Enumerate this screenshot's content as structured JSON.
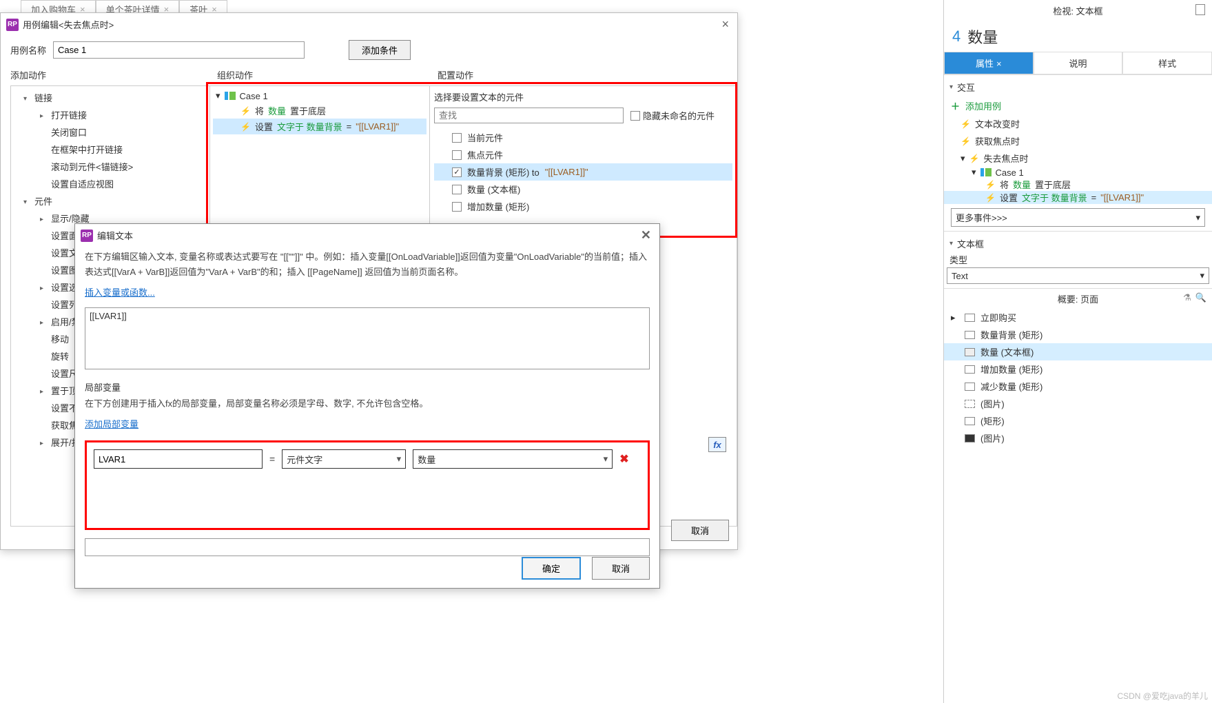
{
  "bg_tabs": [
    "加入购物车",
    "单个茶叶详情",
    "茶叶"
  ],
  "inspector": "检视: 文本框",
  "dialog1": {
    "title": "用例编辑<失去焦点时>",
    "case_label": "用例名称",
    "case_value": "Case 1",
    "add_cond": "添加条件",
    "headers": {
      "add_action": "添加动作",
      "org_action": "组织动作",
      "cfg_action": "配置动作"
    },
    "tree": {
      "links": "链接",
      "open_link": "打开链接",
      "close_win": "关闭窗口",
      "open_in_frame": "在框架中打开链接",
      "scroll_to": "滚动到元件<锚链接>",
      "set_adaptive": "设置自适应视图",
      "widgets": "元件",
      "show_hide": "显示/隐藏",
      "set_panel": "设置面板",
      "set_text": "设置文",
      "set_image": "设置图片",
      "set_sel": "设置选中",
      "set_list": "设置列表",
      "enable": "启用/禁用",
      "move": "移动",
      "rotate": "旋转",
      "set_size": "设置尺寸",
      "to_top": "置于顶",
      "set_opac": "设置不透",
      "get_focus": "获取焦点",
      "expand": "展开/折叠"
    },
    "mid": {
      "case_label": "Case 1",
      "act1_prefix": "将 ",
      "act1_green": "数量",
      "act1_suffix": " 置于底层",
      "act2_prefix": "设置 ",
      "act2_green": "文字于 数量背景",
      "act2_eq": " = ",
      "act2_val": "\"[[LVAR1]]\""
    },
    "right": {
      "header": "选择要设置文本的元件",
      "search_ph": "查找",
      "hide_unnamed": "隐藏未命名的元件",
      "rows": [
        {
          "label": "当前元件",
          "checked": false
        },
        {
          "label": "焦点元件",
          "checked": false
        },
        {
          "label_pre": "数量背景 (矩形) to ",
          "label_val": "\"[[LVAR1]]\"",
          "checked": true,
          "selected": true
        },
        {
          "label": "数量 (文本框)",
          "checked": false
        },
        {
          "label": "增加数量 (矩形)",
          "checked": false
        }
      ]
    },
    "cancel": "取消",
    "fx": "fx"
  },
  "dialog2": {
    "title": "编辑文本",
    "desc": "在下方编辑区输入文本, 变量名称或表达式要写在 \"[[\"\"]]\" 中。例如：插入变量[[OnLoadVariable]]返回值为变量\"OnLoadVariable\"的当前值；插入表达式[[VarA + VarB]]返回值为\"VarA + VarB\"的和；插入 [[PageName]] 返回值为当前页面名称。",
    "insert_var": "插入变量或函数...",
    "textarea": "[[LVAR1]]",
    "local_var": "局部变量",
    "local_desc": "在下方创建用于插入fx的局部变量，局部变量名称必须是字母、数字, 不允许包含空格。",
    "add_local": "添加局部变量",
    "row": {
      "name": "LVAR1",
      "type": "元件文字",
      "target": "数量"
    },
    "ok": "确定",
    "cancel": "取消"
  },
  "rpanel": {
    "big4": "4",
    "qty": "数量",
    "tabs": [
      "属性",
      "说明",
      "样式"
    ],
    "interaction": "交互",
    "add_case": "添加用例",
    "events": {
      "text_change": "文本改变时",
      "got_focus": "获取焦点时",
      "lost_focus": "失去焦点时"
    },
    "case": "Case 1",
    "act1_prefix": "将 ",
    "act1_green": "数量",
    "act1_suffix": " 置于底层",
    "act2_prefix": "设置 ",
    "act2_green": "文字于 数量背景",
    "act2_eq": " = ",
    "act2_val": "\"[[LVAR1]]\"",
    "more": "更多事件>>>",
    "textbox": "文本框",
    "type_label": "类型",
    "type_value": "Text",
    "outline": "概要: 页面",
    "buy_now": "立即购买",
    "outline_items": [
      {
        "label": "数量背景 (矩形)"
      },
      {
        "label": "数量 (文本框)",
        "selected": true
      },
      {
        "label": "增加数量 (矩形)"
      },
      {
        "label": "减少数量 (矩形)"
      },
      {
        "label": "(图片)",
        "dash": true
      },
      {
        "label": "(矩形)"
      },
      {
        "label": "(图片)",
        "black": true
      }
    ]
  },
  "watermark": "CSDN @爱吃java的羊儿"
}
